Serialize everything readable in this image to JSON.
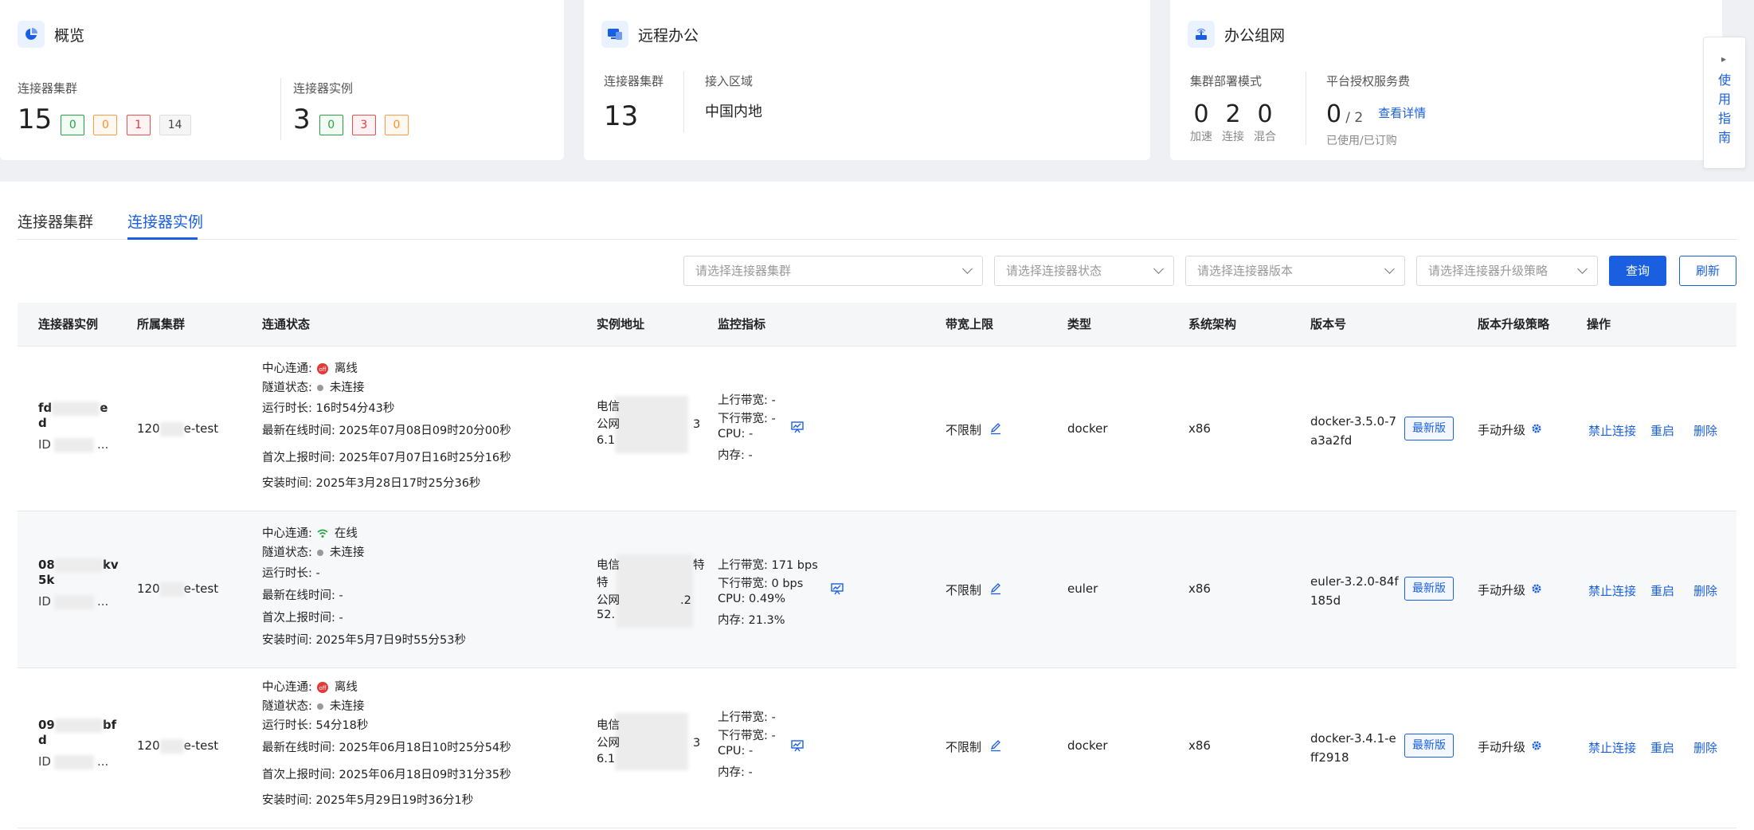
{
  "overview": {
    "title": "概览",
    "cluster_label": "连接器集群",
    "cluster_count": "15",
    "cluster_badges": [
      "0",
      "0",
      "1",
      "14"
    ],
    "instance_label": "连接器实例",
    "instance_count": "3",
    "instance_badges": [
      "0",
      "3",
      "0"
    ]
  },
  "remote": {
    "title": "远程办公",
    "cluster_label": "连接器集群",
    "cluster_count": "13",
    "region_label": "接入区域",
    "region_value": "中国内地"
  },
  "network": {
    "title": "办公组网",
    "mode_label": "集群部署模式",
    "modes": [
      {
        "value": "0",
        "label": "加速"
      },
      {
        "value": "2",
        "label": "连接"
      },
      {
        "value": "0",
        "label": "混合"
      }
    ],
    "fee_label": "平台授权服务费",
    "fee_used": "0",
    "fee_total": "/ 2",
    "fee_link": "查看详情",
    "fee_sub": "已使用/已订购"
  },
  "guide": {
    "text": "使用指南"
  },
  "tabs": [
    "连接器集群",
    "连接器实例"
  ],
  "filters": {
    "cluster_placeholder": "请选择连接器集群",
    "status_placeholder": "请选择连接器状态",
    "version_placeholder": "请选择连接器版本",
    "policy_placeholder": "请选择连接器升级策略",
    "query": "查询",
    "refresh": "刷新"
  },
  "table": {
    "headers": [
      "连接器实例",
      "所属集群",
      "连通状态",
      "实例地址",
      "监控指标",
      "带宽上限",
      "类型",
      "系统架构",
      "版本号",
      "版本升级策略",
      "操作"
    ],
    "labels": {
      "center": "中心连通:",
      "tunnel": "隧道状态:",
      "runtime": "运行时长:",
      "last_online": "最新在线时间:",
      "first_report": "首次上报时间:",
      "install": "安装时间:",
      "up": "上行带宽:",
      "down": "下行带宽:",
      "cpu": "CPU:",
      "mem": "内存:",
      "newest": "最新版",
      "disable": "禁止连接",
      "restart": "重启",
      "delete": "删除"
    },
    "rows": [
      {
        "name_a": "fd",
        "name_a2": "e",
        "name_b": "d",
        "id": "ID",
        "id_tail": "...",
        "cluster_a": "120",
        "cluster_b": "e-test",
        "center": "离线",
        "tunnel": "未连接",
        "runtime": "16时54分43秒",
        "last_online": "2025年07月08日09时20分00秒",
        "first_report": "2025年07月07日16时25分16秒",
        "install": "2025年3月28日17时25分36秒",
        "addr_1": "电信",
        "addr_2": "公网",
        "addr_2b": "3",
        "addr_3": "6.1",
        "up": "-",
        "down": "-",
        "cpu": "-",
        "mem": "-",
        "bandwidth": "不限制",
        "type": "docker",
        "arch": "x86",
        "version_1": "docker-3.5.0-7",
        "version_2": "a3a2fd",
        "policy": "手动升级"
      },
      {
        "name_a": "08",
        "name_a2": "kv",
        "name_b": "5k",
        "id": "ID",
        "id_tail": "...",
        "cluster_a": "120",
        "cluster_b": "e-test",
        "center": "在线",
        "tunnel": "未连接",
        "runtime": "-",
        "last_online": "-",
        "first_report": "-",
        "install": "2025年5月7日9时55分53秒",
        "addr_1": "电信",
        "addr_1b": "特",
        "addr_2": "特",
        "addr_2x": "公网",
        "addr_2b": ".2",
        "addr_3": "52.",
        "up": "171 bps",
        "down": "0 bps",
        "cpu": "0.49%",
        "mem": "21.3%",
        "bandwidth": "不限制",
        "type": "euler",
        "arch": "x86",
        "version_1": "euler-3.2.0-84f",
        "version_2": "185d",
        "policy": "手动升级"
      },
      {
        "name_a": "09",
        "name_a2": "bf",
        "name_b": "d",
        "id": "ID",
        "id_tail": "...",
        "cluster_a": "120",
        "cluster_b": "e-test",
        "center": "离线",
        "tunnel": "未连接",
        "runtime": "54分18秒",
        "last_online": "2025年06月18日10时25分54秒",
        "first_report": "2025年06月18日09时31分35秒",
        "install": "2025年5月29日19时36分1秒",
        "addr_1": "电信",
        "addr_2": "公网",
        "addr_2b": "3",
        "addr_3": "6.1",
        "up": "-",
        "down": "-",
        "cpu": "-",
        "mem": "-",
        "bandwidth": "不限制",
        "type": "docker",
        "arch": "x86",
        "version_1": "docker-3.4.1-e",
        "version_2": "ff2918",
        "policy": "手动升级"
      }
    ]
  },
  "colors": {
    "primary": "#1a5fe0",
    "online": "#27a344",
    "offline": "#e13b3b",
    "warning": "#ff8c2e"
  }
}
